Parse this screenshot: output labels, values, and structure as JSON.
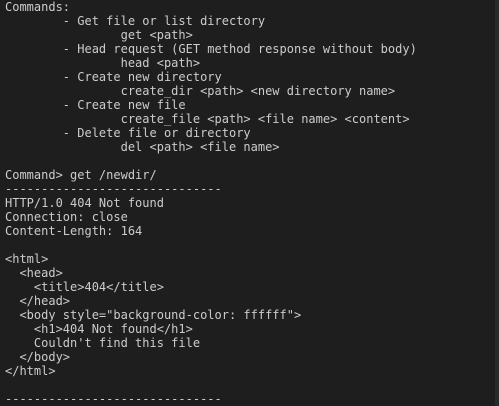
{
  "terminal": {
    "commands_header": "Commands:",
    "help": [
      "        - Get file or list directory",
      "                get <path>",
      "        - Head request (GET method response without body)",
      "                head <path>",
      "        - Create new directory",
      "                create_dir <path> <new directory name>",
      "        - Create new file",
      "                create_file <path> <file name> <content>",
      "        - Delete file or directory",
      "                del <path> <file name>"
    ],
    "prompt_line": "Command> get /newdir/",
    "separator": "------------------------------",
    "response_headers": [
      "HTTP/1.0 404 Not found",
      "Connection: close",
      "Content-Length: 164"
    ],
    "response_body": [
      "<html>",
      "  <head>",
      "    <title>404</title>",
      "  </head>",
      "  <body style=\"background-color: ffffff\">",
      "    <h1>404 Not found</h1>",
      "    Couldn't find this file",
      "  </body>",
      "</html>"
    ],
    "separator_end": "------------------------------"
  },
  "colors": {
    "background": "#1e1e1e",
    "foreground": "#cccccc"
  }
}
